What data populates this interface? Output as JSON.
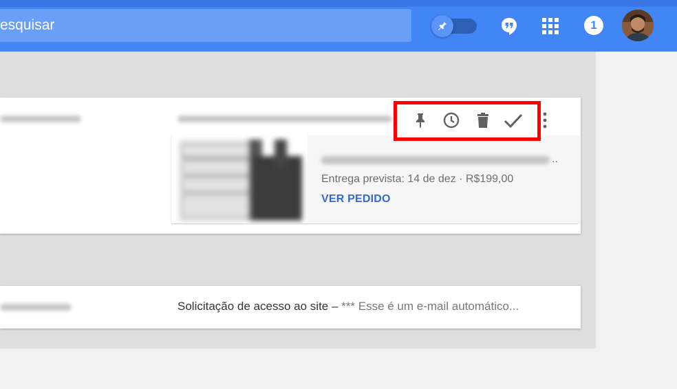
{
  "header": {
    "search_text": "esquisar",
    "notification_count": "1",
    "colors": {
      "bar": "#4285f4",
      "search": "#6a9ff7"
    },
    "icons": [
      "pin-toggle-icon",
      "hangouts-icon",
      "apps-grid-icon",
      "avatar"
    ]
  },
  "inbox": {
    "item1": {
      "actions": [
        "pin-icon",
        "snooze-clock-icon",
        "trash-icon",
        "done-check-icon",
        "more-vert-icon"
      ],
      "highlight_color": "#ff0000",
      "order": {
        "delivery": "Entrega prevista: 14 de dez · R$199,00",
        "view_label": "VER PEDIDO",
        "ellipsis": ".."
      }
    },
    "item2": {
      "subject": "Solicitação de acesso ao site",
      "separator": " – ",
      "snippet": "*** Esse é um e-mail automático..."
    }
  }
}
